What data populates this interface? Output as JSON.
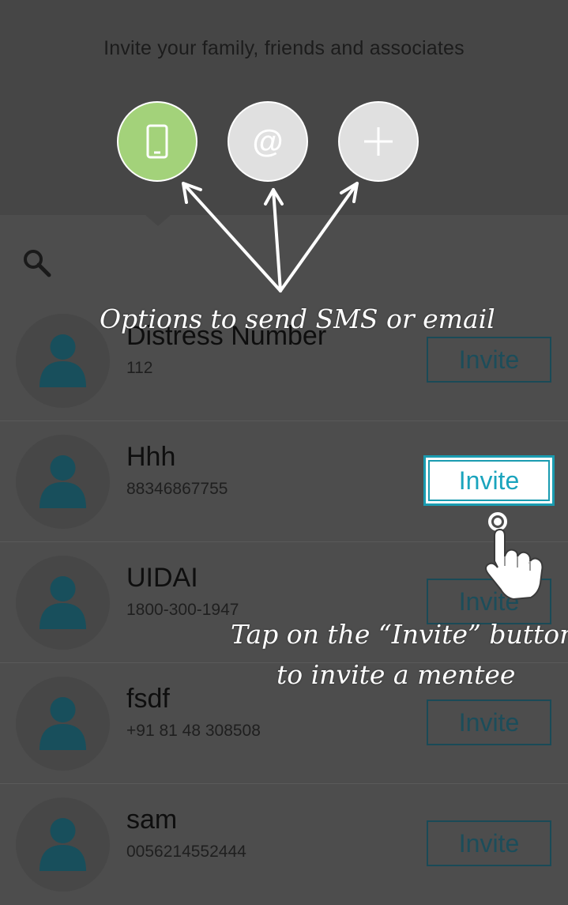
{
  "header": {
    "title": "Invite your family, friends and associates",
    "options": [
      {
        "name": "sms",
        "icon": "phone-icon",
        "active": true,
        "color": "#a3d27a"
      },
      {
        "name": "email",
        "icon": "at-icon",
        "glyph": "@",
        "active": false
      },
      {
        "name": "add",
        "icon": "plus-icon",
        "active": false
      }
    ]
  },
  "search": {
    "icon": "search-icon"
  },
  "contacts": [
    {
      "name": "Distress Number",
      "number": "112",
      "action": "Invite"
    },
    {
      "name": "Hhh",
      "number": "88346867755",
      "action": "Invite"
    },
    {
      "name": "UIDAI",
      "number": "1800-300-1947",
      "action": "Invite"
    },
    {
      "name": "fsdf",
      "number": "+91 81 48 308508",
      "action": "Invite"
    },
    {
      "name": "sam",
      "number": "0056214552444",
      "action": "Invite"
    }
  ],
  "annotations": {
    "options_note": "Options to send SMS or email",
    "tap_note_line1": "Tap on the “Invite” button",
    "tap_note_line2": "to invite a mentee"
  },
  "colors": {
    "accent_green": "#a3d27a",
    "invite_teal": "#1aa4bd",
    "avatar_figure": "#184f5c"
  }
}
